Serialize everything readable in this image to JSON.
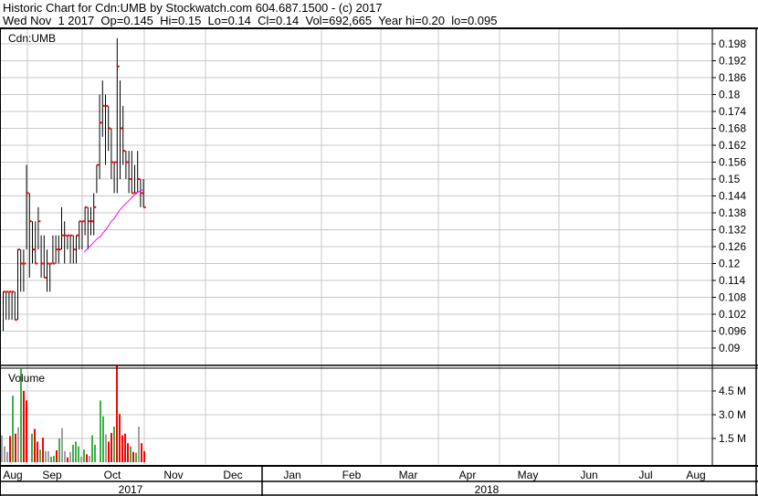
{
  "header": {
    "title": "Historic Chart for Cdn:UMB by Stockwatch.com 604.687.1500 - (c) 2017",
    "quote": "Wed Nov  1 2017  Op=0.145  Hi=0.15  Lo=0.14  Cl=0.14  Vol=692,665  Year hi=0.20  lo=0.095"
  },
  "colors": {
    "up": "#3cb043",
    "down": "#ff0000",
    "flat": "#a0a0a0",
    "close_tick": "#ff0000",
    "ma": "#ff00ff",
    "grid": "#c8c8c8"
  },
  "chart_data": [
    {
      "type": "ohlc",
      "title": "Cdn:UMB",
      "ylim": [
        0.084,
        0.203
      ],
      "yticks": [
        "0.198",
        "0.192",
        "0.186",
        "0.18",
        "0.174",
        "0.168",
        "0.162",
        "0.156",
        "0.15",
        "0.144",
        "0.138",
        "0.132",
        "0.126",
        "0.12",
        "0.114",
        "0.108",
        "0.102",
        "0.096",
        "0.09"
      ],
      "bars": [
        [
          0.11,
          0.096,
          0.11
        ],
        [
          0.11,
          0.1,
          0.11
        ],
        [
          0.11,
          0.1,
          0.11
        ],
        [
          0.11,
          0.1,
          0.11
        ],
        [
          0.11,
          0.1,
          0.1
        ],
        [
          0.125,
          0.1,
          0.125
        ],
        [
          0.125,
          0.11,
          0.12
        ],
        [
          0.125,
          0.11,
          0.12
        ],
        [
          0.155,
          0.125,
          0.145
        ],
        [
          0.145,
          0.115,
          0.135
        ],
        [
          0.135,
          0.12,
          0.125
        ],
        [
          0.135,
          0.12,
          0.12
        ],
        [
          0.14,
          0.125,
          0.135
        ],
        [
          0.13,
          0.115,
          0.12
        ],
        [
          0.13,
          0.115,
          0.115
        ],
        [
          0.125,
          0.11,
          0.12
        ],
        [
          0.12,
          0.11,
          0.12
        ],
        [
          0.13,
          0.12,
          0.12
        ],
        [
          0.13,
          0.12,
          0.125
        ],
        [
          0.13,
          0.12,
          0.125
        ],
        [
          0.14,
          0.125,
          0.13
        ],
        [
          0.135,
          0.12,
          0.13
        ],
        [
          0.13,
          0.125,
          0.13
        ],
        [
          0.13,
          0.12,
          0.13
        ],
        [
          0.13,
          0.12,
          0.125
        ],
        [
          0.13,
          0.12,
          0.13
        ],
        [
          0.135,
          0.125,
          0.135
        ],
        [
          0.135,
          0.125,
          0.135
        ],
        [
          0.14,
          0.13,
          0.14
        ],
        [
          0.14,
          0.125,
          0.135
        ],
        [
          0.14,
          0.13,
          0.135
        ],
        [
          0.145,
          0.13,
          0.14
        ],
        [
          0.155,
          0.145,
          0.155
        ],
        [
          0.18,
          0.15,
          0.17
        ],
        [
          0.185,
          0.165,
          0.176
        ],
        [
          0.18,
          0.155,
          0.176
        ],
        [
          0.176,
          0.16,
          0.168
        ],
        [
          0.168,
          0.15,
          0.156
        ],
        [
          0.156,
          0.145,
          0.156
        ],
        [
          0.2,
          0.145,
          0.19
        ],
        [
          0.185,
          0.15,
          0.168
        ],
        [
          0.176,
          0.155,
          0.16
        ],
        [
          0.16,
          0.15,
          0.156
        ],
        [
          0.16,
          0.145,
          0.15
        ],
        [
          0.16,
          0.145,
          0.145
        ],
        [
          0.155,
          0.145,
          0.145
        ],
        [
          0.16,
          0.145,
          0.15
        ],
        [
          0.15,
          0.14,
          0.145
        ],
        [
          0.15,
          0.14,
          0.14
        ]
      ],
      "moving_average": [
        0.124,
        0.125,
        0.126,
        0.127,
        0.128,
        0.129,
        0.1295,
        0.131,
        0.132,
        0.1335,
        0.135,
        0.136,
        0.1375,
        0.139,
        0.14,
        0.141,
        0.142,
        0.143,
        0.144,
        0.145,
        0.1455,
        0.146,
        0.1465
      ]
    },
    {
      "type": "bar",
      "title": "Volume",
      "yticks": [
        "4.5 M",
        "3.0 M",
        "1.5 M"
      ],
      "ylim": [
        0,
        6200000
      ],
      "values": [
        1700000,
        1000000,
        650000,
        1650000,
        4200000,
        1800000,
        2200000,
        5900000,
        4500000,
        3900000,
        0,
        1800000,
        2100000,
        1300000,
        800000,
        1550000,
        700000,
        700000,
        350000,
        400000,
        750000,
        1500000,
        2150000,
        700000,
        300000,
        650000,
        1100000,
        1300000,
        1000000,
        350000,
        800000,
        500000,
        400000,
        1700000,
        1100000,
        0,
        3900000,
        2900000,
        1750000,
        1300000,
        1850000,
        2250000,
        6100000,
        3050000,
        1700000,
        1800000,
        1200000,
        1000000,
        650000,
        600000,
        2250000,
        1200000,
        700000
      ],
      "colors": [
        "flat",
        "flat",
        "flat",
        "down",
        "up",
        "down",
        "flat",
        "up",
        "down",
        "down",
        "none",
        "up",
        "down",
        "down",
        "up",
        "down",
        "flat",
        "flat",
        "up",
        "up",
        "down",
        "up",
        "flat",
        "flat",
        "down",
        "flat",
        "up",
        "up",
        "up",
        "flat",
        "up",
        "down",
        "flat",
        "up",
        "up",
        "none",
        "up",
        "up",
        "flat",
        "down",
        "down",
        "up",
        "down",
        "down",
        "down",
        "down",
        "down",
        "up",
        "down",
        "up",
        "flat",
        "down",
        "down"
      ]
    }
  ],
  "x_axis": {
    "months": [
      "Aug",
      "Sep",
      "Oct",
      "Nov",
      "Dec",
      "Jan",
      "Feb",
      "Mar",
      "Apr",
      "May",
      "Jun",
      "Jul",
      "Aug"
    ],
    "years": [
      "2017",
      "2018"
    ]
  }
}
